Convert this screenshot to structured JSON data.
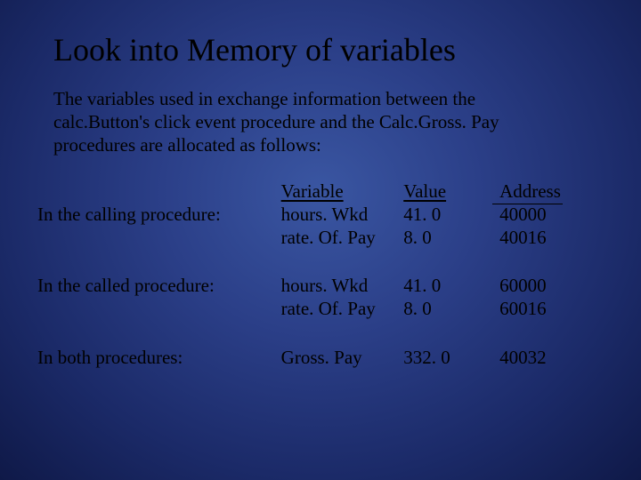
{
  "title": "Look into Memory of variables",
  "intro": "The variables used in exchange information between the calc.Button's click event procedure and the Calc.Gross. Pay procedures are allocated as follows:",
  "headers": {
    "variable": "Variable",
    "value": "Value",
    "address": "Address"
  },
  "rows": [
    {
      "label": "In the calling procedure:",
      "variable": "hours. Wkd\nrate. Of. Pay",
      "value": "41. 0\n8. 0",
      "address": "40000\n40016"
    },
    {
      "label": "In the called procedure:",
      "variable": "hours. Wkd\nrate. Of. Pay",
      "value": "41. 0\n8. 0",
      "address": "60000\n60016"
    },
    {
      "label": "In both procedures:",
      "variable": "Gross. Pay",
      "value": "332. 0",
      "address": "40032"
    }
  ]
}
